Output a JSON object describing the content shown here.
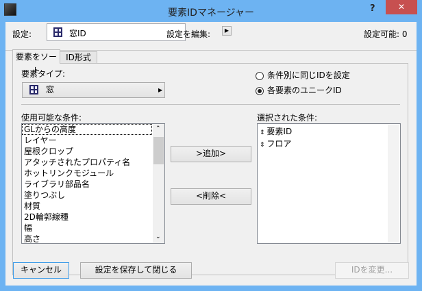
{
  "window": {
    "title": "要素IDマネージャー",
    "help": "?",
    "close": "✕"
  },
  "settings": {
    "label": "設定:",
    "value": "窓ID",
    "edit_label": "設定を編集:",
    "available": "設定可能: 0"
  },
  "tabs": [
    {
      "label": "要素をソート"
    },
    {
      "label": "ID形式"
    }
  ],
  "element_type": {
    "label": "要素タイプ:",
    "value": "窓"
  },
  "radios": [
    {
      "label": "条件別に同じIDを設定",
      "checked": false
    },
    {
      "label": "各要素のユニークID",
      "checked": true
    }
  ],
  "available": {
    "label": "使用可能な条件:",
    "items": [
      "GLからの高度",
      "レイヤー",
      "屋根クロップ",
      "アタッチされたプロパティ名",
      "ホットリンクモジュール",
      "ライブラリ部品名",
      "塗りつぶし",
      "材質",
      "2D輪郭線種",
      "幅",
      "高さ"
    ]
  },
  "selected": {
    "label": "選択された条件:",
    "items": [
      "要素ID",
      "フロア"
    ]
  },
  "buttons": {
    "add": ">追加>",
    "remove": "<削除<",
    "cancel": "キャンセル",
    "save_close": "設定を保存して閉じる",
    "change_id": "IDを変更..."
  }
}
